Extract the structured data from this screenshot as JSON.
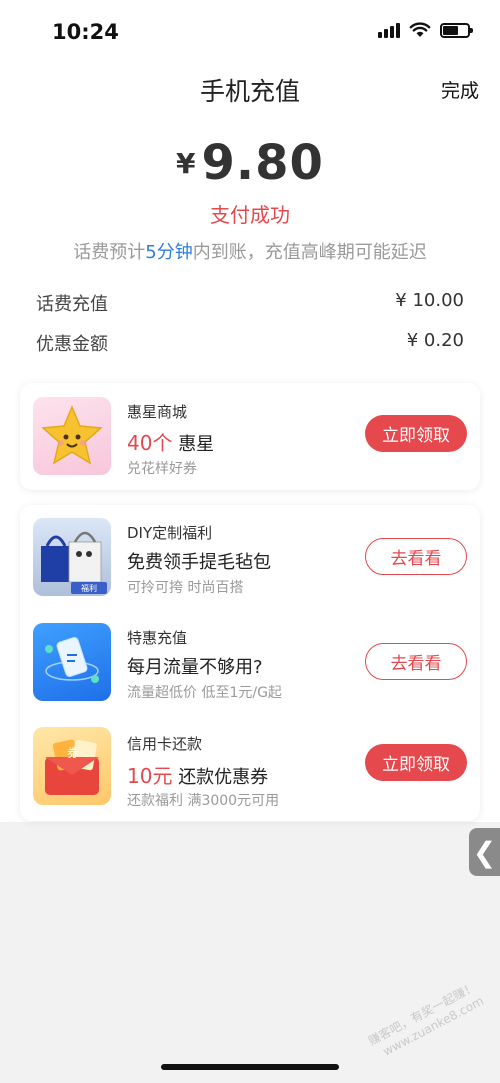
{
  "status_bar": {
    "time": "10:24"
  },
  "nav": {
    "title": "手机充值",
    "done_label": "完成"
  },
  "payment": {
    "currency_symbol": "¥",
    "amount": "9.80",
    "status": "支付成功",
    "note_prefix": "话费预计",
    "note_highlight": "5分钟",
    "note_suffix": "内到账，充值高峰期可能延迟"
  },
  "details": [
    {
      "label": "话费充值",
      "value": "¥ 10.00"
    },
    {
      "label": "优惠金额",
      "value": "¥ 0.20"
    }
  ],
  "promos": [
    {
      "category": "惠星商城",
      "highlight": "40个",
      "title": "惠星",
      "subtitle": "兑花样好券",
      "button": "立即领取",
      "icon": "star-icon"
    },
    {
      "category": "DIY定制福利",
      "highlight": "",
      "title": "免费领手提毛毡包",
      "subtitle": "可拎可挎 时尚百搭",
      "button": "去看看",
      "icon": "tote-bag-icon",
      "badge": "福利"
    },
    {
      "category": "特惠充值",
      "highlight": "",
      "title": "每月流量不够用?",
      "subtitle": "流量超低价 低至1元/G起",
      "button": "去看看",
      "icon": "data-plan-icon"
    },
    {
      "category": "信用卡还款",
      "highlight": "10元",
      "title": "还款优惠券",
      "subtitle": "还款福利 满3000元可用",
      "button": "立即领取",
      "icon": "red-envelope-icon",
      "coupon_char": "券"
    }
  ],
  "side_tab": {
    "glyph": "❮"
  },
  "watermark": {
    "line1": "赚客吧，有奖一起赚！",
    "line2": "www.zuanke8.com"
  },
  "colors": {
    "accent_red": "#e5484d",
    "highlight_blue": "#2f7de1",
    "muted_gray": "#9a9a9a"
  }
}
